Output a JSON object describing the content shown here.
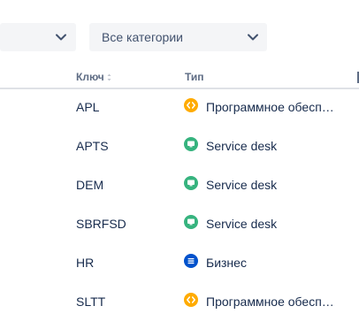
{
  "filters": {
    "left_select_value": "",
    "category_select_value": "Все категории"
  },
  "table": {
    "headers": {
      "key": "Ключ",
      "type": "Тип"
    },
    "rows": [
      {
        "key": "APL",
        "type": "Программное обеспечение",
        "type_icon": "software-icon",
        "icon_color": "#ffab00"
      },
      {
        "key": "APTS",
        "type": "Service desk",
        "type_icon": "service-desk-icon",
        "icon_color": "#36b37e"
      },
      {
        "key": "DEM",
        "type": "Service desk",
        "type_icon": "service-desk-icon",
        "icon_color": "#36b37e"
      },
      {
        "key": "SBRFSD",
        "type": "Service desk",
        "type_icon": "service-desk-icon",
        "icon_color": "#36b37e"
      },
      {
        "key": "HR",
        "type": "Бизнес",
        "type_icon": "business-icon",
        "icon_color": "#0052cc"
      },
      {
        "key": "SLTT",
        "type": "Программное обеспечение",
        "type_icon": "software-icon",
        "icon_color": "#ffab00"
      }
    ]
  },
  "colors": {
    "select_background": "#f4f5f7",
    "header_text": "#5e6c84",
    "body_text": "#172b4d",
    "divider": "#dfe1e6"
  }
}
